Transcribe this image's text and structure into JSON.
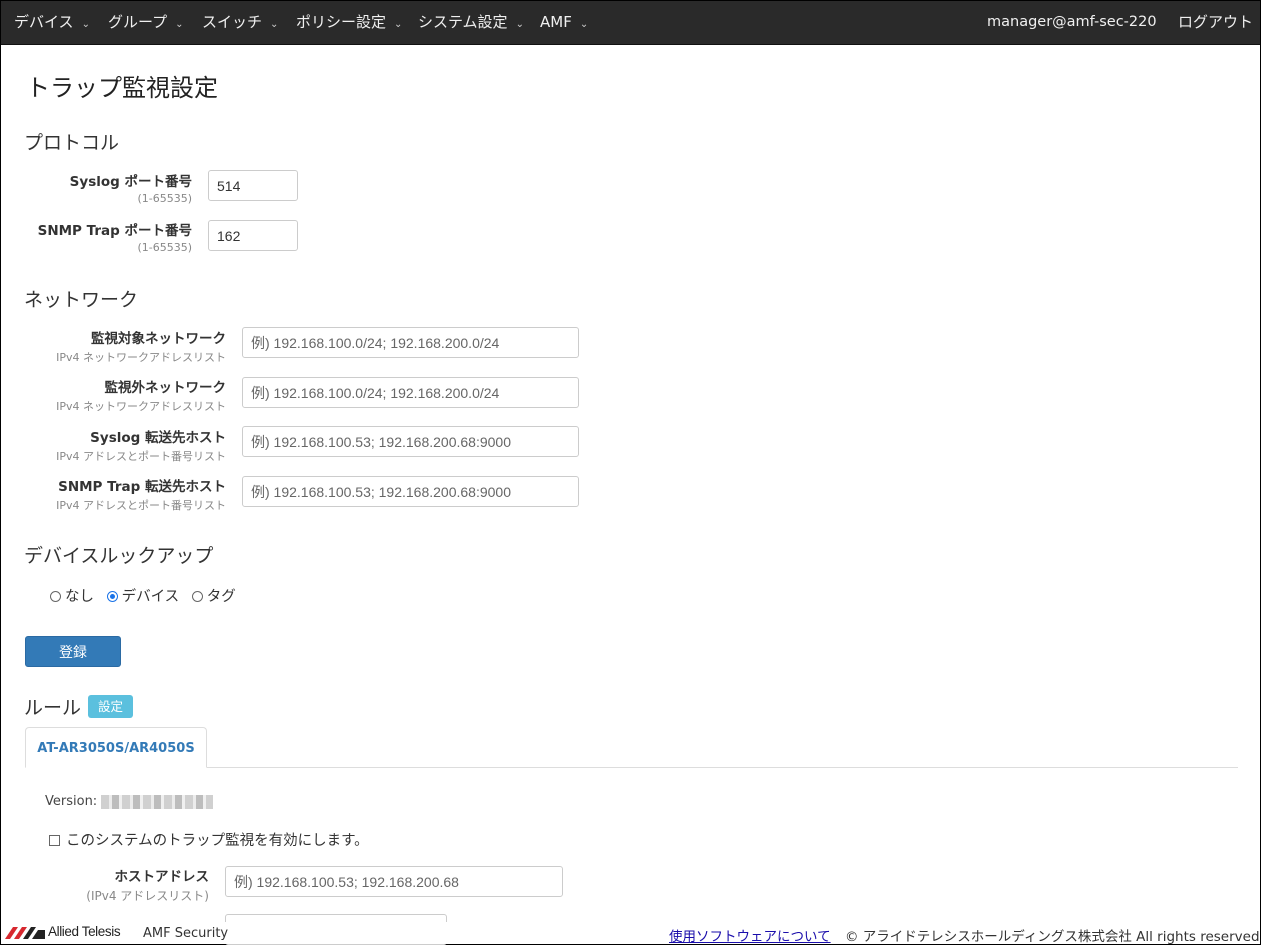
{
  "nav": {
    "items": [
      {
        "label": "デバイス"
      },
      {
        "label": "グループ"
      },
      {
        "label": "スイッチ"
      },
      {
        "label": "ポリシー設定"
      },
      {
        "label": "システム設定"
      },
      {
        "label": "AMF"
      }
    ],
    "user": "manager@amf-sec-220",
    "logout": "ログアウト"
  },
  "page": {
    "title": "トラップ監視設定"
  },
  "protocol": {
    "title": "プロトコル",
    "syslog_port": {
      "label": "Syslog ポート番号",
      "hint": "(1-65535)",
      "value": "514"
    },
    "snmp_port": {
      "label": "SNMP Trap ポート番号",
      "hint": "(1-65535)",
      "value": "162"
    }
  },
  "network": {
    "title": "ネットワーク",
    "monitored": {
      "label": "監視対象ネットワーク",
      "hint": "IPv4 ネットワークアドレスリスト",
      "placeholder": "例) 192.168.100.0/24; 192.168.200.0/24"
    },
    "excluded": {
      "label": "監視外ネットワーク",
      "hint": "IPv4 ネットワークアドレスリスト",
      "placeholder": "例) 192.168.100.0/24; 192.168.200.0/24"
    },
    "syslog_forward": {
      "label": "Syslog 転送先ホスト",
      "hint": "IPv4 アドレスとポート番号リスト",
      "placeholder": "例) 192.168.100.53; 192.168.200.68:9000"
    },
    "snmp_forward": {
      "label": "SNMP Trap 転送先ホスト",
      "hint": "IPv4 アドレスとポート番号リスト",
      "placeholder": "例) 192.168.100.53; 192.168.200.68:9000"
    }
  },
  "lookup": {
    "title": "デバイスルックアップ",
    "options": [
      {
        "label": "なし",
        "selected": false
      },
      {
        "label": "デバイス",
        "selected": true
      },
      {
        "label": "タグ",
        "selected": false
      }
    ]
  },
  "submit_label": "登録",
  "rules": {
    "title": "ルール",
    "settings_badge": "設定",
    "tab": "AT-AR3050S/AR4050S",
    "version_label": "Version:",
    "enable_label": "このシステムのトラップ監視を有効にします。",
    "enabled": false,
    "host": {
      "label": "ホストアドレス",
      "hint": "(IPv4 アドレスリスト)",
      "placeholder": "例) 192.168.100.53; 192.168.200.68"
    }
  },
  "footer": {
    "brand": "Allied Telesis",
    "product": "AMF Security",
    "link": "使用ソフトウェアについて",
    "copyright": "© アライドテレシスホールディングス株式会社 All rights reserved."
  },
  "colors": {
    "navbar": "#2a2a2a",
    "primary": "#337ab7",
    "info": "#5bc0de",
    "logo_red": "#d7282f"
  }
}
